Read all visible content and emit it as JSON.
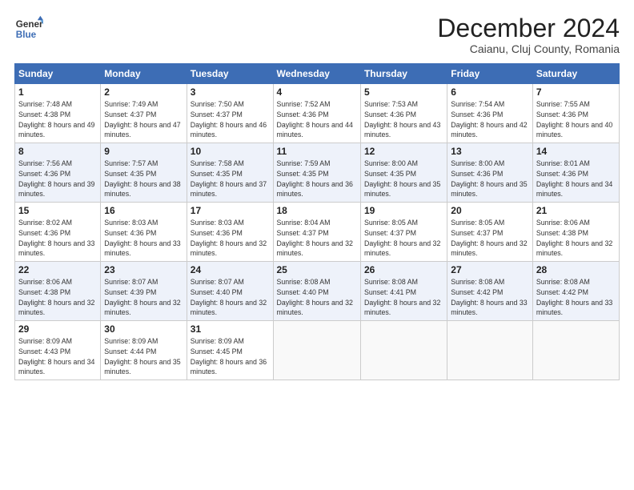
{
  "header": {
    "logo_line1": "General",
    "logo_line2": "Blue",
    "main_title": "December 2024",
    "subtitle": "Caianu, Cluj County, Romania"
  },
  "weekdays": [
    "Sunday",
    "Monday",
    "Tuesday",
    "Wednesday",
    "Thursday",
    "Friday",
    "Saturday"
  ],
  "weeks": [
    [
      {
        "day": "1",
        "sunrise": "7:48 AM",
        "sunset": "4:38 PM",
        "daylight": "8 hours and 49 minutes."
      },
      {
        "day": "2",
        "sunrise": "7:49 AM",
        "sunset": "4:37 PM",
        "daylight": "8 hours and 47 minutes."
      },
      {
        "day": "3",
        "sunrise": "7:50 AM",
        "sunset": "4:37 PM",
        "daylight": "8 hours and 46 minutes."
      },
      {
        "day": "4",
        "sunrise": "7:52 AM",
        "sunset": "4:36 PM",
        "daylight": "8 hours and 44 minutes."
      },
      {
        "day": "5",
        "sunrise": "7:53 AM",
        "sunset": "4:36 PM",
        "daylight": "8 hours and 43 minutes."
      },
      {
        "day": "6",
        "sunrise": "7:54 AM",
        "sunset": "4:36 PM",
        "daylight": "8 hours and 42 minutes."
      },
      {
        "day": "7",
        "sunrise": "7:55 AM",
        "sunset": "4:36 PM",
        "daylight": "8 hours and 40 minutes."
      }
    ],
    [
      {
        "day": "8",
        "sunrise": "7:56 AM",
        "sunset": "4:36 PM",
        "daylight": "8 hours and 39 minutes."
      },
      {
        "day": "9",
        "sunrise": "7:57 AM",
        "sunset": "4:35 PM",
        "daylight": "8 hours and 38 minutes."
      },
      {
        "day": "10",
        "sunrise": "7:58 AM",
        "sunset": "4:35 PM",
        "daylight": "8 hours and 37 minutes."
      },
      {
        "day": "11",
        "sunrise": "7:59 AM",
        "sunset": "4:35 PM",
        "daylight": "8 hours and 36 minutes."
      },
      {
        "day": "12",
        "sunrise": "8:00 AM",
        "sunset": "4:35 PM",
        "daylight": "8 hours and 35 minutes."
      },
      {
        "day": "13",
        "sunrise": "8:00 AM",
        "sunset": "4:36 PM",
        "daylight": "8 hours and 35 minutes."
      },
      {
        "day": "14",
        "sunrise": "8:01 AM",
        "sunset": "4:36 PM",
        "daylight": "8 hours and 34 minutes."
      }
    ],
    [
      {
        "day": "15",
        "sunrise": "8:02 AM",
        "sunset": "4:36 PM",
        "daylight": "8 hours and 33 minutes."
      },
      {
        "day": "16",
        "sunrise": "8:03 AM",
        "sunset": "4:36 PM",
        "daylight": "8 hours and 33 minutes."
      },
      {
        "day": "17",
        "sunrise": "8:03 AM",
        "sunset": "4:36 PM",
        "daylight": "8 hours and 32 minutes."
      },
      {
        "day": "18",
        "sunrise": "8:04 AM",
        "sunset": "4:37 PM",
        "daylight": "8 hours and 32 minutes."
      },
      {
        "day": "19",
        "sunrise": "8:05 AM",
        "sunset": "4:37 PM",
        "daylight": "8 hours and 32 minutes."
      },
      {
        "day": "20",
        "sunrise": "8:05 AM",
        "sunset": "4:37 PM",
        "daylight": "8 hours and 32 minutes."
      },
      {
        "day": "21",
        "sunrise": "8:06 AM",
        "sunset": "4:38 PM",
        "daylight": "8 hours and 32 minutes."
      }
    ],
    [
      {
        "day": "22",
        "sunrise": "8:06 AM",
        "sunset": "4:38 PM",
        "daylight": "8 hours and 32 minutes."
      },
      {
        "day": "23",
        "sunrise": "8:07 AM",
        "sunset": "4:39 PM",
        "daylight": "8 hours and 32 minutes."
      },
      {
        "day": "24",
        "sunrise": "8:07 AM",
        "sunset": "4:40 PM",
        "daylight": "8 hours and 32 minutes."
      },
      {
        "day": "25",
        "sunrise": "8:08 AM",
        "sunset": "4:40 PM",
        "daylight": "8 hours and 32 minutes."
      },
      {
        "day": "26",
        "sunrise": "8:08 AM",
        "sunset": "4:41 PM",
        "daylight": "8 hours and 32 minutes."
      },
      {
        "day": "27",
        "sunrise": "8:08 AM",
        "sunset": "4:42 PM",
        "daylight": "8 hours and 33 minutes."
      },
      {
        "day": "28",
        "sunrise": "8:08 AM",
        "sunset": "4:42 PM",
        "daylight": "8 hours and 33 minutes."
      }
    ],
    [
      {
        "day": "29",
        "sunrise": "8:09 AM",
        "sunset": "4:43 PM",
        "daylight": "8 hours and 34 minutes."
      },
      {
        "day": "30",
        "sunrise": "8:09 AM",
        "sunset": "4:44 PM",
        "daylight": "8 hours and 35 minutes."
      },
      {
        "day": "31",
        "sunrise": "8:09 AM",
        "sunset": "4:45 PM",
        "daylight": "8 hours and 36 minutes."
      },
      null,
      null,
      null,
      null
    ]
  ]
}
